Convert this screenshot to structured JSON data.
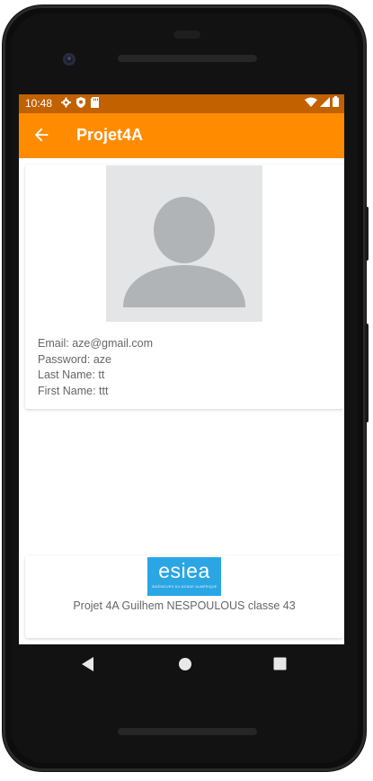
{
  "status_bar": {
    "time": "10:48",
    "left_icons": [
      "gear-icon",
      "shield-icon",
      "sd-card-icon"
    ],
    "right_icons": [
      "wifi-icon",
      "signal-icon",
      "battery-icon"
    ],
    "color": "#c26100"
  },
  "app_bar": {
    "title": "Projet4A",
    "color": "#ff8c00"
  },
  "profile": {
    "email_line": "Email: aze@gmail.com",
    "password_line": "Password: aze",
    "last_name_line": "Last Name: tt",
    "first_name_line": "First Name: ttt"
  },
  "footer": {
    "logo_text": "esiea",
    "logo_tagline": "INGÉNIEURS DU MONDE NUMÉRIQUE",
    "logo_color": "#2aa6e4",
    "credit": "Projet 4A Guilhem NESPOULOUS classe 43"
  },
  "nav": {
    "back_icon": "triangle-back-icon",
    "home_icon": "circle-home-icon",
    "recents_icon": "square-recents-icon"
  }
}
